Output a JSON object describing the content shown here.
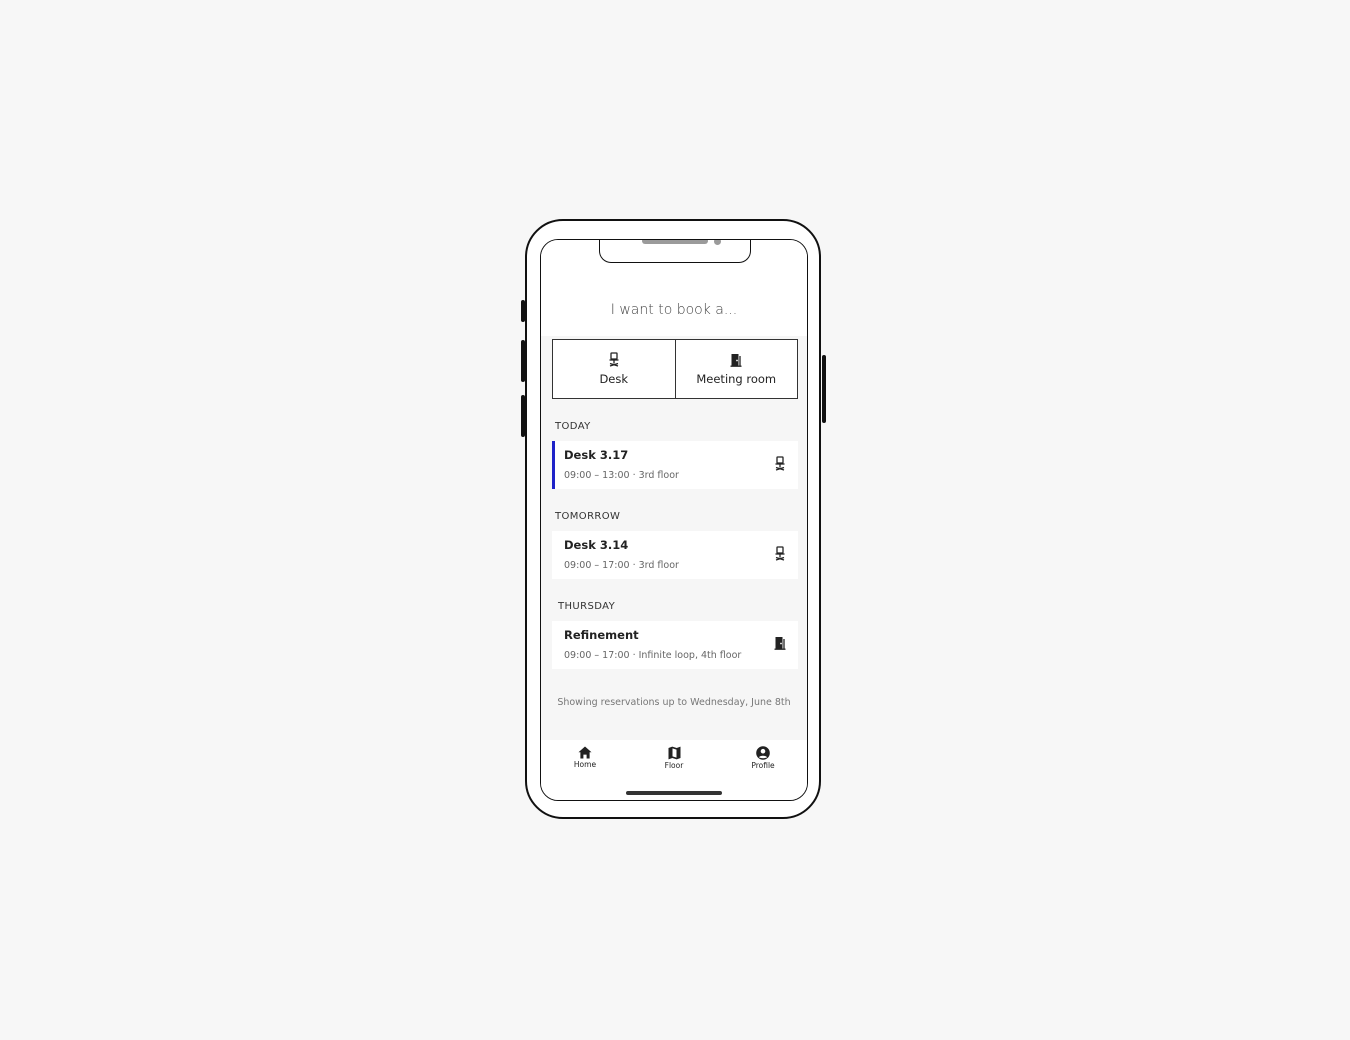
{
  "header": {
    "title": "I want to book a..."
  },
  "booking_options": [
    {
      "label": "Desk",
      "icon": "office-chair-icon"
    },
    {
      "label": "Meeting room",
      "icon": "door-icon"
    }
  ],
  "sections": [
    {
      "label": "TODAY",
      "reservation": {
        "title": "Desk 3.17",
        "details": "09:00 – 13:00 · 3rd floor",
        "icon": "office-chair-icon",
        "active": true
      }
    },
    {
      "label": "TOMORROW",
      "reservation": {
        "title": "Desk 3.14",
        "details": "09:00 – 17:00 · 3rd floor",
        "icon": "office-chair-icon"
      }
    },
    {
      "label": "THURSDAY",
      "reservation": {
        "title": "Refinement",
        "details": "09:00 – 17:00 · Infinite loop, 4th floor",
        "icon": "door-icon"
      }
    }
  ],
  "footer_note": "Showing reservations up to Wednesday, June 8th",
  "tabs": [
    {
      "label": "Home",
      "icon": "home-icon"
    },
    {
      "label": "Floor",
      "icon": "map-icon"
    },
    {
      "label": "Profile",
      "icon": "account-icon"
    }
  ],
  "colors": {
    "accent": "#1e22c8",
    "background": "#f7f7f7"
  }
}
